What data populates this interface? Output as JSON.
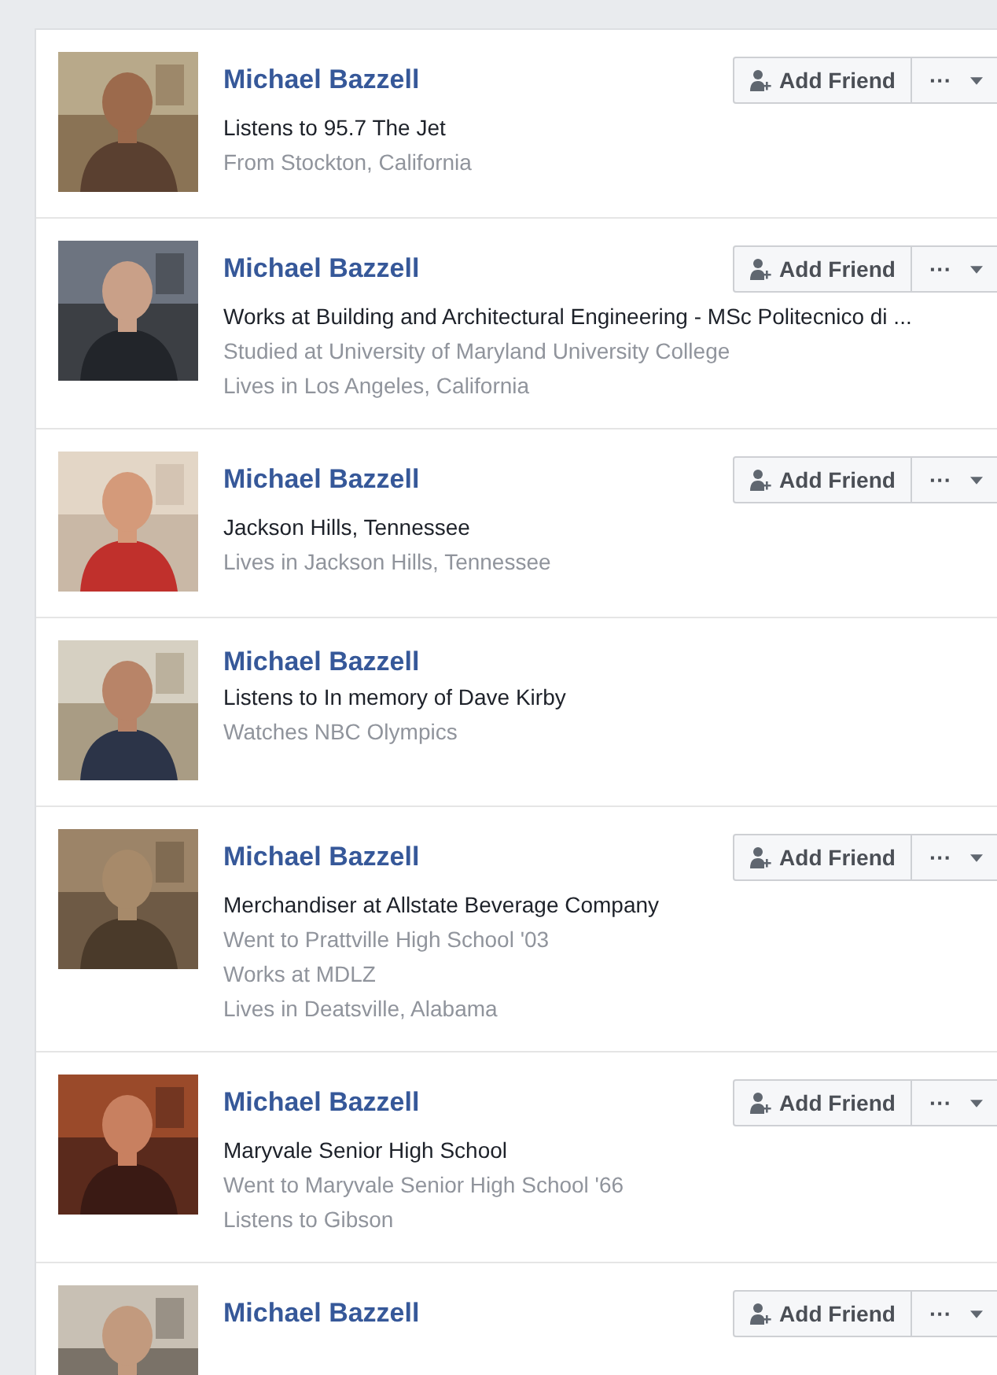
{
  "results": [
    {
      "name": "Michael Bazzell",
      "photo": {
        "kind": "picture"
      },
      "details": [
        "Listens to 95.7 The Jet",
        "From Stockton, California"
      ],
      "actions": {
        "add_friend": "Add Friend",
        "more": "···"
      }
    },
    {
      "name": "Michael Bazzell",
      "photo": {
        "kind": "picture"
      },
      "details": [
        "Works at Building and Architectural Engineering - MSc Politecnico di ...",
        "Studied at University of Maryland University College",
        "Lives in Los Angeles, California"
      ],
      "actions": {
        "add_friend": "Add Friend",
        "more": "···"
      }
    },
    {
      "name": "Michael Bazzell",
      "photo": {
        "kind": "picture"
      },
      "details": [
        "Jackson Hills, Tennessee",
        "Lives in Jackson Hills, Tennessee"
      ],
      "actions": {
        "add_friend": "Add Friend",
        "more": "···"
      }
    },
    {
      "name": "Michael Bazzell",
      "photo": {
        "kind": "picture"
      },
      "details": [
        "Listens to In memory of Dave Kirby",
        "Watches NBC Olympics"
      ]
    },
    {
      "name": "Michael Bazzell",
      "photo": {
        "kind": "picture"
      },
      "details": [
        "Merchandiser at Allstate Beverage Company",
        "Went to Prattville High School '03",
        "Works at MDLZ",
        "Lives in Deatsville, Alabama"
      ],
      "actions": {
        "add_friend": "Add Friend",
        "more": "···"
      }
    },
    {
      "name": "Michael Bazzell",
      "photo": {
        "kind": "picture"
      },
      "details": [
        "Maryvale Senior High School",
        "Went to Maryvale Senior High School '66",
        "Listens to Gibson"
      ],
      "actions": {
        "add_friend": "Add Friend",
        "more": "···"
      }
    },
    {
      "name": "Michael Bazzell",
      "photo": {
        "kind": "picture"
      },
      "actions": {
        "add_friend": "Add Friend",
        "more": "···"
      }
    }
  ]
}
